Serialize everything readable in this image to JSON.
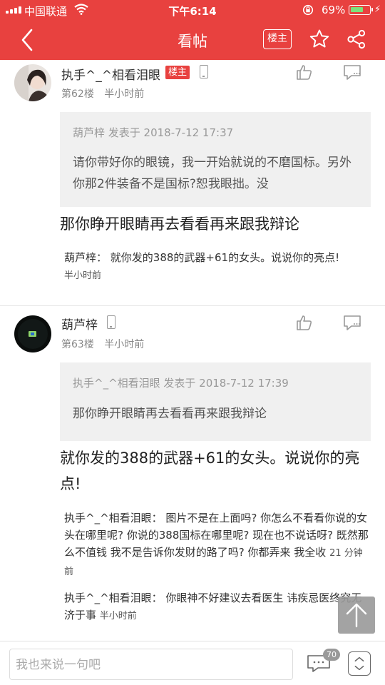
{
  "status_bar": {
    "carrier": "中国联通",
    "time": "下午6:14",
    "battery_pct": "69%",
    "battery_level": 0.69
  },
  "nav": {
    "title": "看帖",
    "host_only_label": "楼主"
  },
  "posts": [
    {
      "user": "执手^_^相看泪眼",
      "host_tag": "楼主",
      "floor": "第62楼",
      "time": "半小时前",
      "quote_header": "葫芦梓 发表于 2018-7-12 17:37",
      "quote_body": "请你带好你的眼镜，我一开始就说的不磨国标。另外你那2件装备不是国标?恕我眼拙。没",
      "content": "那你睁开眼睛再去看看再来跟我辩论",
      "replies": [
        {
          "author": "葫芦梓：",
          "text": "就你发的388的武器+61的女头。说说你的亮点!",
          "time": "半小时前"
        }
      ]
    },
    {
      "user": "葫芦梓",
      "floor": "第63楼",
      "time": "半小时前",
      "quote_header": "执手^_^相看泪眼 发表于 2018-7-12 17:39",
      "quote_body": "那你睁开眼睛再去看看再来跟我辩论",
      "content": "就你发的388的武器+61的女头。说说你的亮点!",
      "replies": [
        {
          "author": "执手^_^相看泪眼：",
          "text": "图片不是在上面吗? 你怎么不看看你说的女头在哪里呢? 你说的388国标在哪里呢? 现在也不说话呀? 既然那么不值钱 我不是告诉你发财的路了吗? 你都弄来 我全收",
          "time": "21 分钟前"
        },
        {
          "author": "执手^_^相看泪眼：",
          "text": "你眼神不好建议去看医生 讳疾忌医终究无济于事",
          "time": "半小时前"
        }
      ]
    }
  ],
  "bottom_bar": {
    "input_placeholder": "我也来说一句吧",
    "comment_count": "70"
  },
  "colors": {
    "brand_red": "#e8413f",
    "quote_bg": "#f0f0f0"
  }
}
